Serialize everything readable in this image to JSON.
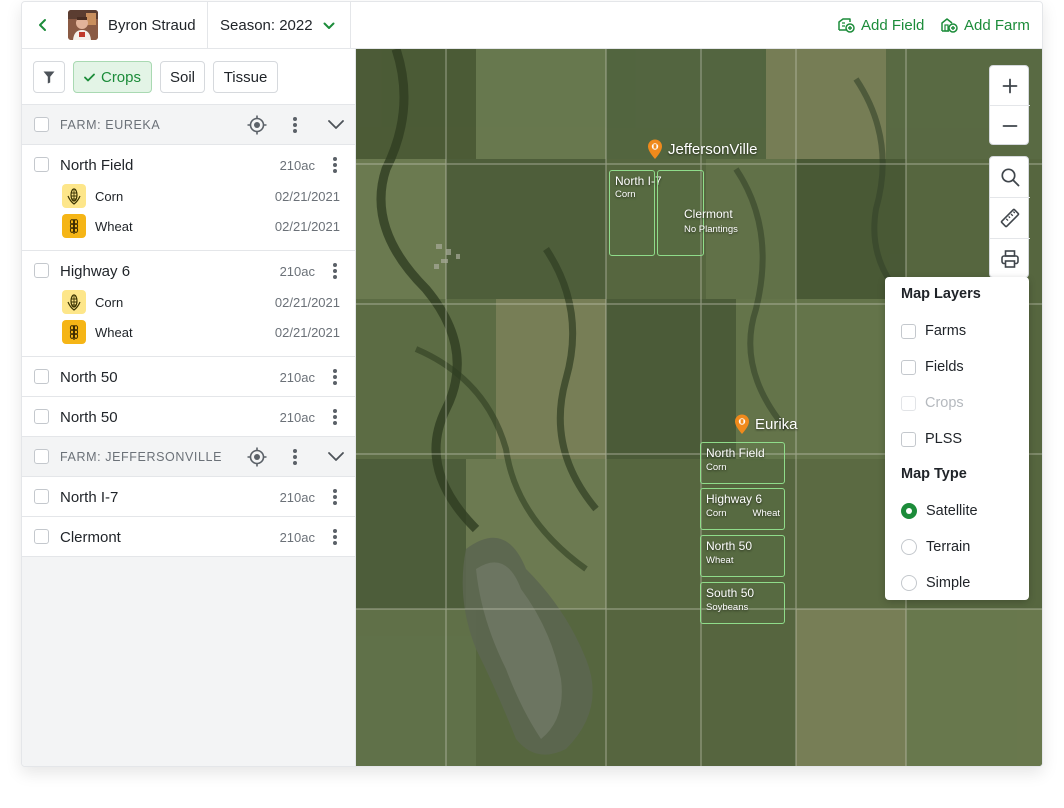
{
  "header": {
    "back_icon": "chevron-left-icon",
    "user_name": "Byron Straud",
    "season_label": "Season: 2022",
    "add_field_label": "Add Field",
    "add_farm_label": "Add Farm",
    "accent_color": "#1c8c3a"
  },
  "filters": {
    "filter_icon": "funnel-icon",
    "crops_label": "Crops",
    "soil_label": "Soil",
    "tissue_label": "Tissue",
    "active": "Crops"
  },
  "farms": [
    {
      "label": "FARM: EUREKA",
      "fields": [
        {
          "name": "North Field",
          "acres": "210ac",
          "crops": [
            {
              "name": "Corn",
              "date": "02/21/2021"
            },
            {
              "name": "Wheat",
              "date": "02/21/2021"
            }
          ]
        },
        {
          "name": "Highway 6",
          "acres": "210ac",
          "crops": [
            {
              "name": "Corn",
              "date": "02/21/2021"
            },
            {
              "name": "Wheat",
              "date": "02/21/2021"
            }
          ]
        },
        {
          "name": "North 50",
          "acres": "210ac"
        },
        {
          "name": "North 50",
          "acres": "210ac"
        }
      ]
    },
    {
      "label": "FARM: JEFFERSONVILLE",
      "fields": [
        {
          "name": "North I-7",
          "acres": "210ac"
        },
        {
          "name": "Clermont",
          "acres": "210ac"
        }
      ]
    }
  ],
  "map": {
    "markers": [
      {
        "label": "JeffersonVille"
      },
      {
        "label": "Eurika"
      }
    ],
    "jefferson_fields": [
      {
        "title": "North I-7",
        "sub": "Corn"
      },
      {
        "title": "Clermont",
        "sub": "No Plantings"
      }
    ],
    "eureka_fields": [
      {
        "title": "North Field",
        "sub": "Corn"
      },
      {
        "title": "Highway 6",
        "sub": "Corn",
        "sub2": "Wheat"
      },
      {
        "title": "North 50",
        "sub": "Wheat"
      },
      {
        "title": "South 50",
        "sub": "Soybeans"
      }
    ],
    "controls": [
      "zoom-in-icon",
      "zoom-out-icon",
      "search-icon",
      "ruler-icon",
      "printer-icon"
    ]
  },
  "layers_panel": {
    "layers_title": "Map Layers",
    "layers": [
      {
        "label": "Farms",
        "checked": false,
        "disabled": false
      },
      {
        "label": "Fields",
        "checked": false,
        "disabled": false
      },
      {
        "label": "Crops",
        "checked": false,
        "disabled": true
      },
      {
        "label": "PLSS",
        "checked": false,
        "disabled": false
      }
    ],
    "type_title": "Map Type",
    "types": [
      {
        "label": "Satellite",
        "selected": true
      },
      {
        "label": "Terrain",
        "selected": false
      },
      {
        "label": "Simple",
        "selected": false
      }
    ]
  }
}
